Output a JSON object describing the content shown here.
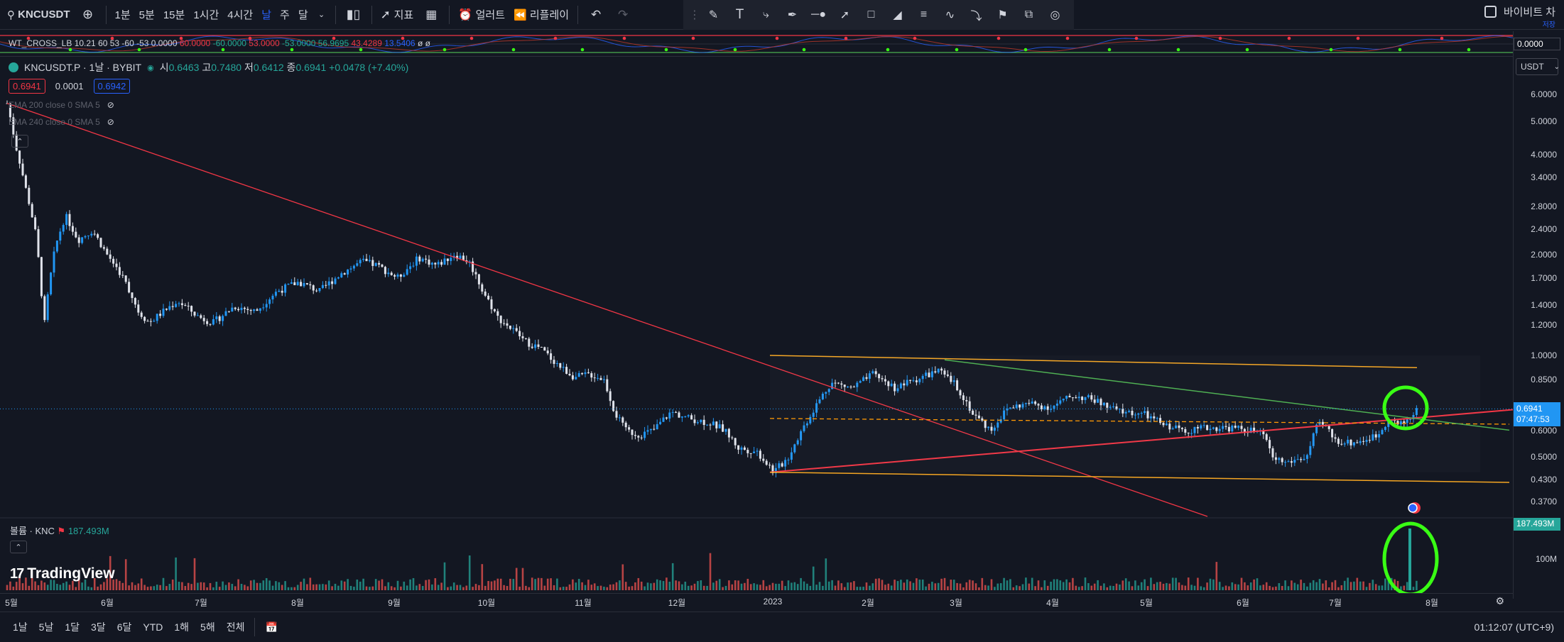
{
  "toolbar": {
    "symbol": "KNCUSDT",
    "intervals": [
      "1분",
      "5분",
      "15분",
      "1시간",
      "4시간",
      "날",
      "주",
      "달"
    ],
    "active_interval": "날",
    "indicators_label": "지표",
    "alert_label": "얼러트",
    "replay_label": "리플레이",
    "exchange_title": "바이비트 차",
    "save_label": "저장"
  },
  "indicator_strip": {
    "name": "WT_CROSS_LB",
    "values_white": "10.21 60 53 -60 -53",
    "v1": "0.0000",
    "v2": "60.0000",
    "v3": "-60.0000",
    "v4": "53.0000",
    "v5": "-53.0000",
    "v6": "56.9695",
    "v7": "43.4289",
    "v8": "13.5406",
    "v9": "ø ø",
    "tag_value": "0.0000"
  },
  "legend": {
    "title": "KNCUSDT.P · 1날 · BYBIT",
    "open_label": "시",
    "open": "0.6463",
    "high_label": "고",
    "high": "0.7480",
    "low_label": "저",
    "low": "0.6412",
    "close_label": "종",
    "close": "0.6941",
    "change": "+0.0478 (+7.40%)",
    "bid": "0.6941",
    "spread": "0.0001",
    "ask": "0.6942"
  },
  "ema": {
    "ema200": "EMA 200 close 0 SMA 5",
    "ema240": "EMA 240 close 0 SMA 5"
  },
  "volume": {
    "label": "볼륨 · KNC",
    "value": "187.493M",
    "axis_label": "100M"
  },
  "price_axis": {
    "currency": "USDT",
    "labels": [
      "6.0000",
      "5.0000",
      "4.0000",
      "3.4000",
      "2.8000",
      "2.4000",
      "2.0000",
      "1.7000",
      "1.4000",
      "1.2000",
      "1.0000",
      "0.8500",
      "0.6000",
      "0.5000",
      "0.4300",
      "0.3700"
    ],
    "last_price": "0.6941",
    "countdown": "07:47:53"
  },
  "time_axis": {
    "labels": [
      "5월",
      "6월",
      "7월",
      "8월",
      "9월",
      "10월",
      "11월",
      "12월",
      "2023",
      "2월",
      "3월",
      "4월",
      "5월",
      "6월",
      "7월",
      "8월"
    ]
  },
  "bottombar": {
    "ranges": [
      "1날",
      "5날",
      "1달",
      "3달",
      "6달",
      "YTD",
      "1해",
      "5해",
      "전체"
    ],
    "clock": "01:12:07 (UTC+9)"
  },
  "branding": {
    "logo_text": "TradingView"
  },
  "colors": {
    "up": "#26a69a",
    "down": "#ef5350",
    "trend_red": "#f23645",
    "channel_orange": "#f5a623",
    "trend_green": "#4caf50",
    "highlight": "#39ff14"
  }
}
